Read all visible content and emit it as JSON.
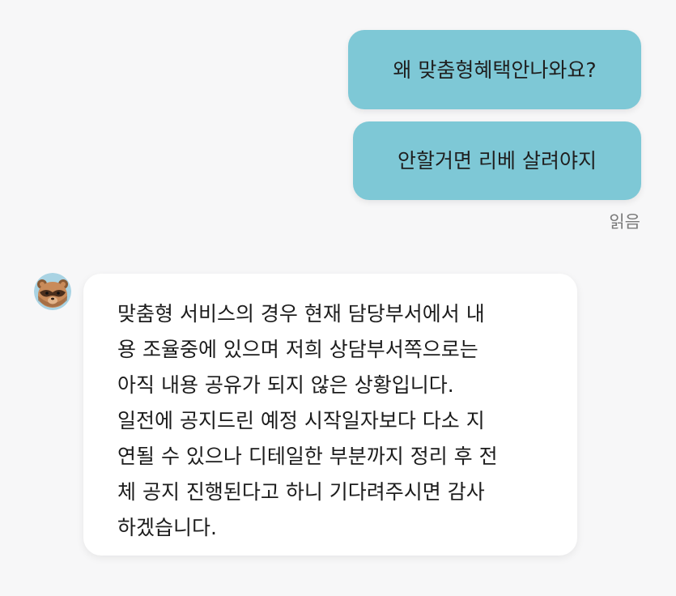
{
  "chat": {
    "outgoing": [
      {
        "text": "왜 맞춤형혜택안나와요?"
      },
      {
        "text": "안할거면 리베 살려야지"
      }
    ],
    "read_status": "읽음",
    "incoming": {
      "avatar_icon": "raccoon-avatar-icon",
      "lines": [
        "맞춤형 서비스의 경우 현재 담당부서에서 내",
        "용 조율중에 있으며 저희 상담부서쪽으로는",
        "아직 내용 공유가 되지 않은 상황입니다.",
        "일전에 공지드린 예정 시작일자보다 다소 지",
        "연될 수 있으나 디테일한 부분까지 정리 후 전",
        "체 공지 진행된다고 하니 기다려주시면 감사",
        "하겠습니다."
      ]
    },
    "colors": {
      "outgoing_bubble": "#7ec8d6",
      "incoming_bubble": "#ffffff",
      "background": "#f7f7f8"
    }
  }
}
